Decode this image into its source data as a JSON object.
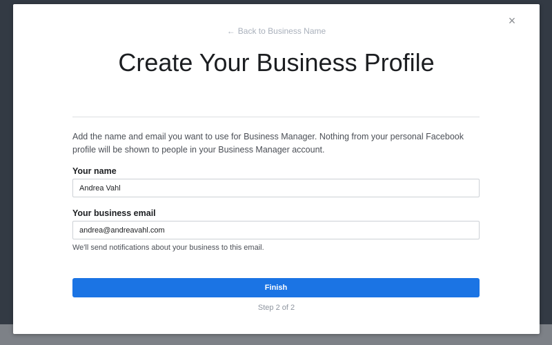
{
  "modal": {
    "close_icon": "close-icon",
    "close_glyph": "×",
    "back_arrow": "←",
    "back_link_label": "Back to Business Name",
    "title": "Create Your Business Profile",
    "description": "Add the name and email you want to use for Business Manager. Nothing from your personal Facebook profile will be shown to people in your Business Manager account.",
    "name_field": {
      "label": "Your name",
      "value": "Andrea Vahl"
    },
    "email_field": {
      "label": "Your business email",
      "value": "andrea@andreavahl.com"
    },
    "helper_text": "We'll send notifications about your business to this email.",
    "finish_label": "Finish",
    "step_text": "Step 2 of 2"
  },
  "colors": {
    "accent": "#1b74e4",
    "backdrop": "#333a44"
  }
}
